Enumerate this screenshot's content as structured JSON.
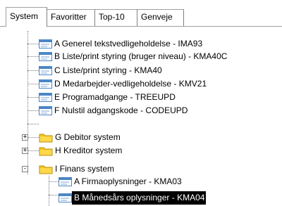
{
  "tabs": [
    {
      "label": "System",
      "active": true
    },
    {
      "label": "Favoritter"
    },
    {
      "label": "Top-10"
    },
    {
      "label": "Genveje"
    }
  ],
  "tree": {
    "items": [
      {
        "label": "A Generel tekstvedligeholdelse - IMA93",
        "icon": "document-icon"
      },
      {
        "label": "B Liste/print styring (bruger niveau) - KMA40C",
        "icon": "document-icon"
      },
      {
        "label": "C Liste/print styring - KMA40",
        "icon": "document-icon"
      },
      {
        "label": "D Medarbejder-vedligeholdelse - KMV21",
        "icon": "document-icon"
      },
      {
        "label": "E Programadgange - TREEUPD",
        "icon": "document-icon"
      },
      {
        "label": "F Nulstil adgangskode - CODEUPD",
        "icon": "document-icon"
      },
      {
        "label": "G Debitor system",
        "icon": "folder-icon",
        "expander": "+"
      },
      {
        "label": "H Kreditor system",
        "icon": "folder-icon",
        "expander": "+"
      },
      {
        "label": "I Finans system",
        "icon": "folder-icon",
        "expander": "-"
      },
      {
        "label": "A Firmaoplysninger - KMA03",
        "icon": "document-icon"
      },
      {
        "label": "B Månedsårs oplysninger - KMA04",
        "icon": "document-icon",
        "selected": true
      }
    ]
  },
  "colors": {
    "folder": "#f5c518",
    "doc_header": "#4a86c8",
    "selection": "#000000"
  }
}
